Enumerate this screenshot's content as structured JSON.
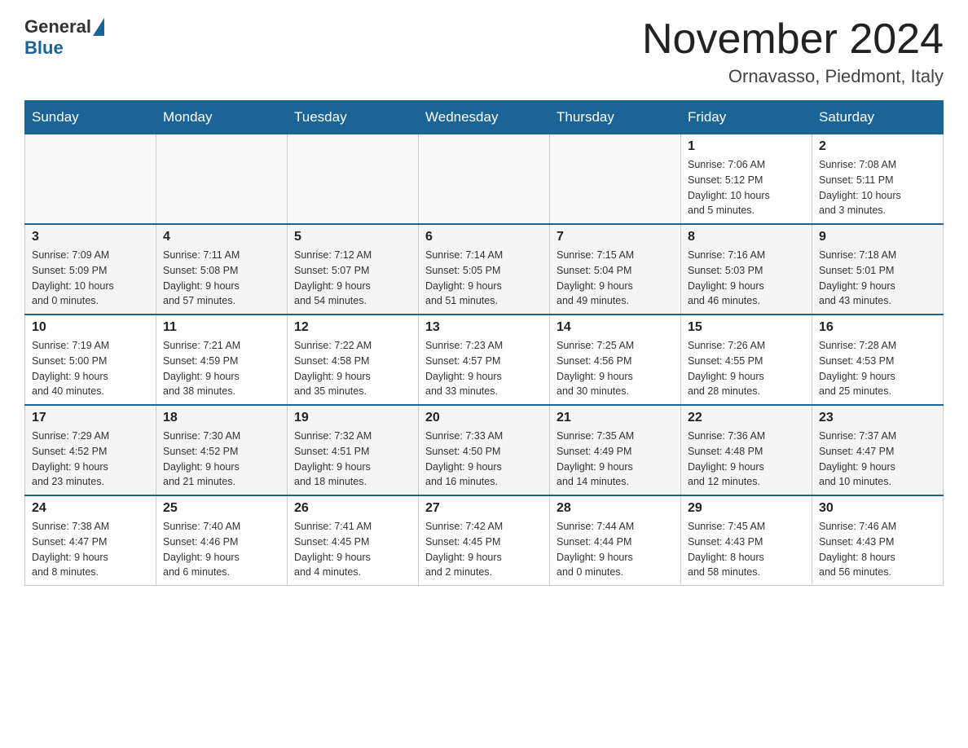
{
  "header": {
    "logo_general": "General",
    "logo_blue": "Blue",
    "month_title": "November 2024",
    "location": "Ornavasso, Piedmont, Italy"
  },
  "weekdays": [
    "Sunday",
    "Monday",
    "Tuesday",
    "Wednesday",
    "Thursday",
    "Friday",
    "Saturday"
  ],
  "weeks": [
    [
      {
        "day": "",
        "info": ""
      },
      {
        "day": "",
        "info": ""
      },
      {
        "day": "",
        "info": ""
      },
      {
        "day": "",
        "info": ""
      },
      {
        "day": "",
        "info": ""
      },
      {
        "day": "1",
        "info": "Sunrise: 7:06 AM\nSunset: 5:12 PM\nDaylight: 10 hours\nand 5 minutes."
      },
      {
        "day": "2",
        "info": "Sunrise: 7:08 AM\nSunset: 5:11 PM\nDaylight: 10 hours\nand 3 minutes."
      }
    ],
    [
      {
        "day": "3",
        "info": "Sunrise: 7:09 AM\nSunset: 5:09 PM\nDaylight: 10 hours\nand 0 minutes."
      },
      {
        "day": "4",
        "info": "Sunrise: 7:11 AM\nSunset: 5:08 PM\nDaylight: 9 hours\nand 57 minutes."
      },
      {
        "day": "5",
        "info": "Sunrise: 7:12 AM\nSunset: 5:07 PM\nDaylight: 9 hours\nand 54 minutes."
      },
      {
        "day": "6",
        "info": "Sunrise: 7:14 AM\nSunset: 5:05 PM\nDaylight: 9 hours\nand 51 minutes."
      },
      {
        "day": "7",
        "info": "Sunrise: 7:15 AM\nSunset: 5:04 PM\nDaylight: 9 hours\nand 49 minutes."
      },
      {
        "day": "8",
        "info": "Sunrise: 7:16 AM\nSunset: 5:03 PM\nDaylight: 9 hours\nand 46 minutes."
      },
      {
        "day": "9",
        "info": "Sunrise: 7:18 AM\nSunset: 5:01 PM\nDaylight: 9 hours\nand 43 minutes."
      }
    ],
    [
      {
        "day": "10",
        "info": "Sunrise: 7:19 AM\nSunset: 5:00 PM\nDaylight: 9 hours\nand 40 minutes."
      },
      {
        "day": "11",
        "info": "Sunrise: 7:21 AM\nSunset: 4:59 PM\nDaylight: 9 hours\nand 38 minutes."
      },
      {
        "day": "12",
        "info": "Sunrise: 7:22 AM\nSunset: 4:58 PM\nDaylight: 9 hours\nand 35 minutes."
      },
      {
        "day": "13",
        "info": "Sunrise: 7:23 AM\nSunset: 4:57 PM\nDaylight: 9 hours\nand 33 minutes."
      },
      {
        "day": "14",
        "info": "Sunrise: 7:25 AM\nSunset: 4:56 PM\nDaylight: 9 hours\nand 30 minutes."
      },
      {
        "day": "15",
        "info": "Sunrise: 7:26 AM\nSunset: 4:55 PM\nDaylight: 9 hours\nand 28 minutes."
      },
      {
        "day": "16",
        "info": "Sunrise: 7:28 AM\nSunset: 4:53 PM\nDaylight: 9 hours\nand 25 minutes."
      }
    ],
    [
      {
        "day": "17",
        "info": "Sunrise: 7:29 AM\nSunset: 4:52 PM\nDaylight: 9 hours\nand 23 minutes."
      },
      {
        "day": "18",
        "info": "Sunrise: 7:30 AM\nSunset: 4:52 PM\nDaylight: 9 hours\nand 21 minutes."
      },
      {
        "day": "19",
        "info": "Sunrise: 7:32 AM\nSunset: 4:51 PM\nDaylight: 9 hours\nand 18 minutes."
      },
      {
        "day": "20",
        "info": "Sunrise: 7:33 AM\nSunset: 4:50 PM\nDaylight: 9 hours\nand 16 minutes."
      },
      {
        "day": "21",
        "info": "Sunrise: 7:35 AM\nSunset: 4:49 PM\nDaylight: 9 hours\nand 14 minutes."
      },
      {
        "day": "22",
        "info": "Sunrise: 7:36 AM\nSunset: 4:48 PM\nDaylight: 9 hours\nand 12 minutes."
      },
      {
        "day": "23",
        "info": "Sunrise: 7:37 AM\nSunset: 4:47 PM\nDaylight: 9 hours\nand 10 minutes."
      }
    ],
    [
      {
        "day": "24",
        "info": "Sunrise: 7:38 AM\nSunset: 4:47 PM\nDaylight: 9 hours\nand 8 minutes."
      },
      {
        "day": "25",
        "info": "Sunrise: 7:40 AM\nSunset: 4:46 PM\nDaylight: 9 hours\nand 6 minutes."
      },
      {
        "day": "26",
        "info": "Sunrise: 7:41 AM\nSunset: 4:45 PM\nDaylight: 9 hours\nand 4 minutes."
      },
      {
        "day": "27",
        "info": "Sunrise: 7:42 AM\nSunset: 4:45 PM\nDaylight: 9 hours\nand 2 minutes."
      },
      {
        "day": "28",
        "info": "Sunrise: 7:44 AM\nSunset: 4:44 PM\nDaylight: 9 hours\nand 0 minutes."
      },
      {
        "day": "29",
        "info": "Sunrise: 7:45 AM\nSunset: 4:43 PM\nDaylight: 8 hours\nand 58 minutes."
      },
      {
        "day": "30",
        "info": "Sunrise: 7:46 AM\nSunset: 4:43 PM\nDaylight: 8 hours\nand 56 minutes."
      }
    ]
  ]
}
